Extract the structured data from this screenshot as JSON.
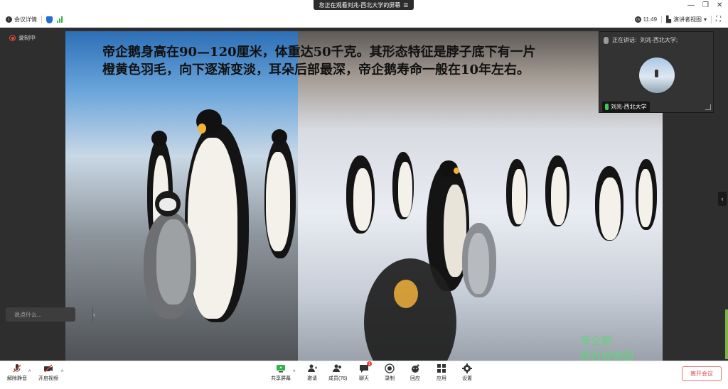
{
  "banner": {
    "text": "您正在观看刘兆-西北大学的屏幕"
  },
  "infobar": {
    "meeting_details": "会议详情",
    "time": "11:49",
    "view_mode": "演讲者视图"
  },
  "recording": {
    "label": "录制中"
  },
  "slide": {
    "line1": "帝企鹅身高在90—120厘米，体重达50千克。其形态特征是脖子底下有一片",
    "line2": "橙黄色羽毛，向下逐渐变淡，耳朵后部最深，帝企鹅寿命一般在10年左右。",
    "caption1": "帝企鹅",
    "caption2": "杨召提供图"
  },
  "speaker": {
    "label": "正在讲话:",
    "name": "刘兆-西北大学;",
    "tag_name": "刘兆-西北大学"
  },
  "chat": {
    "placeholder": "说点什么..."
  },
  "toolbar": {
    "unmute": "解除静音",
    "video": "开启视频",
    "share": "共享屏幕",
    "invite": "邀请",
    "members": "成员(76)",
    "chat": "聊天",
    "chat_badge": "1",
    "record": "录制",
    "playback": "回应",
    "apps": "应用",
    "settings": "设置",
    "leave": "离开会议"
  },
  "colors": {
    "accent_blue": "#1f6ed4",
    "record_red": "#e74c3c",
    "leave_red": "#e04343",
    "signal_green": "#2fb34a",
    "caption_green": "#5fd47a"
  }
}
